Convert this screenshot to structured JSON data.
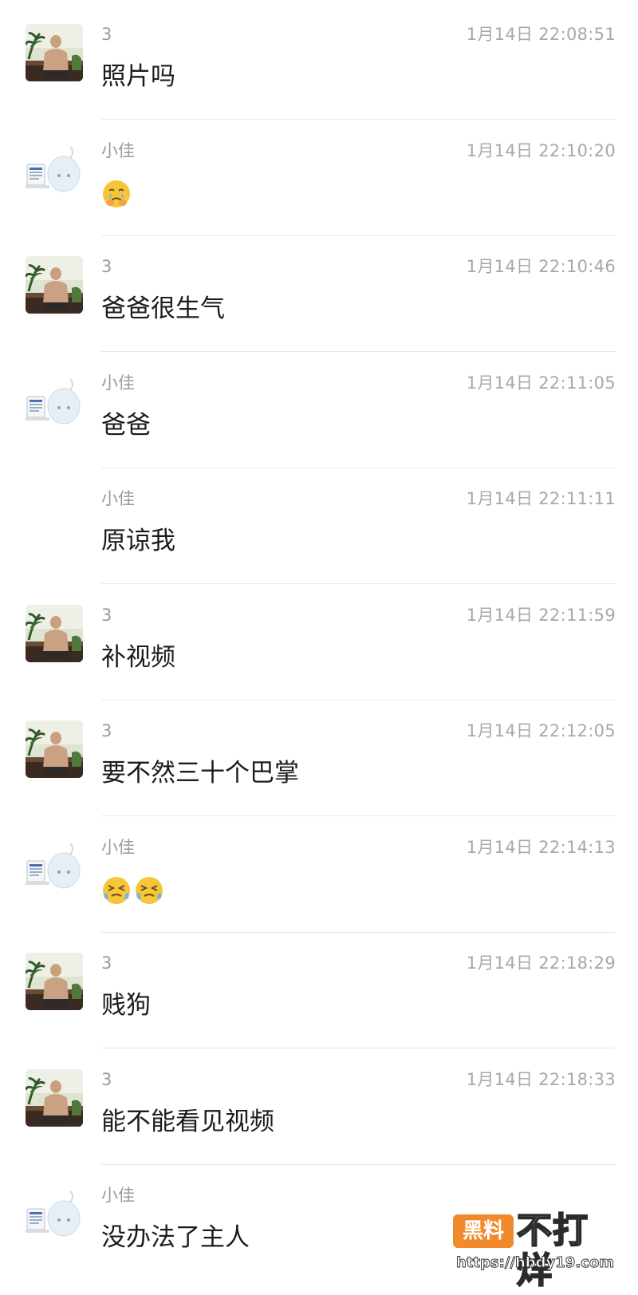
{
  "messages": [
    {
      "sender": "3",
      "time": "1月14日 22:08:51",
      "text": "照片吗",
      "avatar": "man-avatar",
      "emojis": []
    },
    {
      "sender": "小佳",
      "time": "1月14日 22:10:20",
      "text": "",
      "avatar": "cartoon-avatar",
      "emojis": [
        "tearful-face-emoji"
      ]
    },
    {
      "sender": "3",
      "time": "1月14日 22:10:46",
      "text": "爸爸很生气",
      "avatar": "man-avatar",
      "emojis": []
    },
    {
      "sender": "小佳",
      "time": "1月14日 22:11:05",
      "text": "爸爸",
      "avatar": "cartoon-avatar",
      "emojis": []
    },
    {
      "sender": "小佳",
      "time": "1月14日 22:11:11",
      "text": "原谅我",
      "avatar": "none",
      "emojis": []
    },
    {
      "sender": "3",
      "time": "1月14日 22:11:59",
      "text": "补视频",
      "avatar": "man-avatar",
      "emojis": []
    },
    {
      "sender": "3",
      "time": "1月14日 22:12:05",
      "text": "要不然三十个巴掌",
      "avatar": "man-avatar",
      "emojis": []
    },
    {
      "sender": "小佳",
      "time": "1月14日 22:14:13",
      "text": "",
      "avatar": "cartoon-avatar",
      "emojis": [
        "crying-squint-face-emoji",
        "crying-squint-face-emoji"
      ]
    },
    {
      "sender": "3",
      "time": "1月14日 22:18:29",
      "text": "贱狗",
      "avatar": "man-avatar",
      "emojis": []
    },
    {
      "sender": "3",
      "time": "1月14日 22:18:33",
      "text": "能不能看见视频",
      "avatar": "man-avatar",
      "emojis": []
    },
    {
      "sender": "小佳",
      "time": "",
      "text": "没办法了主人",
      "avatar": "cartoon-avatar",
      "emojis": []
    }
  ],
  "watermark": {
    "badge": "黑料",
    "title": "不打烊",
    "url": "https://hbdy19.com"
  },
  "colors": {
    "sender": "#9a9a9a",
    "time": "#a8a8a8",
    "text": "#1c1c1c",
    "divider": "#e8e8e8",
    "watermark_badge": "#f08a2c"
  }
}
